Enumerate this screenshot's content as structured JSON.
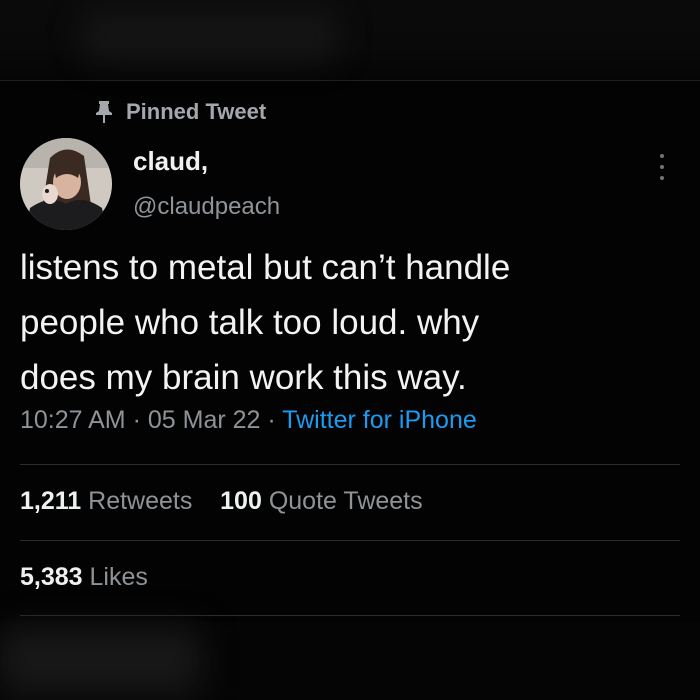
{
  "pinned_label": "Pinned Tweet",
  "author": {
    "name": "claud,",
    "handle": "@claudpeach"
  },
  "tweet": {
    "text_lines": [
      "listens to metal but can’t handle",
      "people who talk too loud. why",
      "does my brain work this way."
    ],
    "time": "10:27 AM",
    "separator": "·",
    "date": "05 Mar 22",
    "source": "Twitter for iPhone"
  },
  "stats": {
    "retweets_count": "1,211",
    "retweets_label": "Retweets",
    "quotes_count": "100",
    "quotes_label": "Quote Tweets",
    "likes_count": "5,383",
    "likes_label": "Likes"
  },
  "icons": {
    "pin": "pin-icon",
    "more": "more-vertical-icon"
  },
  "colors": {
    "background": "#000000",
    "link": "#1d9bf0",
    "secondary_text": "#8e9398"
  }
}
